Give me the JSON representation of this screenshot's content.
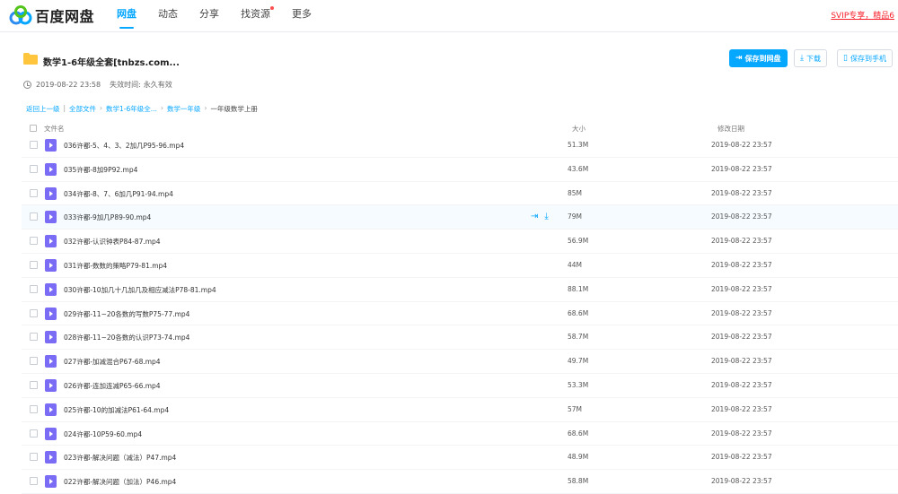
{
  "brand": {
    "logo_text": "百度网盘"
  },
  "nav": {
    "items": [
      {
        "label": "网盘"
      },
      {
        "label": "动态"
      },
      {
        "label": "分享"
      },
      {
        "label": "找资源"
      },
      {
        "label": "更多"
      }
    ],
    "active_index": 0,
    "svip_link": "SVIP专享，精品6"
  },
  "share": {
    "title": "数学1-6年级全套[tnbzs.com...",
    "created": "2019-08-22 23:58",
    "expire_label": "失效时间:",
    "expire_value": "永久有效",
    "buttons": {
      "save": "保存到网盘",
      "download": "下载",
      "save_phone": "保存到手机"
    }
  },
  "breadcrumb": {
    "back": "返回上一级",
    "sep1": "|",
    "all_files": "全部文件",
    "level1": "数学1-6年级全...",
    "level2": "数学一年级",
    "current": "一年级数学上册",
    "arrow": "›"
  },
  "table": {
    "headers": {
      "name": "文件名",
      "size": "大小",
      "date": "修改日期"
    },
    "rows": [
      {
        "name": "036许都-5、4、3、2加几P95-96.mp4",
        "size": "51.3M",
        "date": "2019-08-22 23:57"
      },
      {
        "name": "035许都-8加9P92.mp4",
        "size": "43.6M",
        "date": "2019-08-22 23:57"
      },
      {
        "name": "034许都-8、7、6加几P91-94.mp4",
        "size": "85M",
        "date": "2019-08-22 23:57"
      },
      {
        "name": "033许都-9加几P89-90.mp4",
        "size": "79M",
        "date": "2019-08-22 23:57"
      },
      {
        "name": "032许都-认识钟表P84-87.mp4",
        "size": "56.9M",
        "date": "2019-08-22 23:57"
      },
      {
        "name": "031许都-数数的策略P79-81.mp4",
        "size": "44M",
        "date": "2019-08-22 23:57"
      },
      {
        "name": "030许都-10加几十几加几及相应减法P78-81.mp4",
        "size": "88.1M",
        "date": "2019-08-22 23:57"
      },
      {
        "name": "029许都-11~20各数的写数P75-77.mp4",
        "size": "68.6M",
        "date": "2019-08-22 23:57"
      },
      {
        "name": "028许都-11~20各数的认识P73-74.mp4",
        "size": "58.7M",
        "date": "2019-08-22 23:57"
      },
      {
        "name": "027许都-加减混合P67-68.mp4",
        "size": "49.7M",
        "date": "2019-08-22 23:57"
      },
      {
        "name": "026许都-连加连减P65-66.mp4",
        "size": "53.3M",
        "date": "2019-08-22 23:57"
      },
      {
        "name": "025许都-10的加减法P61-64.mp4",
        "size": "57M",
        "date": "2019-08-22 23:57"
      },
      {
        "name": "024许都-10P59-60.mp4",
        "size": "68.6M",
        "date": "2019-08-22 23:57"
      },
      {
        "name": "023许都-解决问题（减法）P47.mp4",
        "size": "48.9M",
        "date": "2019-08-22 23:57"
      },
      {
        "name": "022许都-解决问题（加法）P46.mp4",
        "size": "58.8M",
        "date": "2019-08-22 23:57"
      }
    ],
    "hover_row_index": 3,
    "row_action_icons": [
      "save-icon",
      "download-icon"
    ]
  },
  "colors": {
    "accent": "#06a7ff",
    "video_icon": "#7b6cf6",
    "folder": "#ffc53d",
    "alert": "#f5222d"
  }
}
